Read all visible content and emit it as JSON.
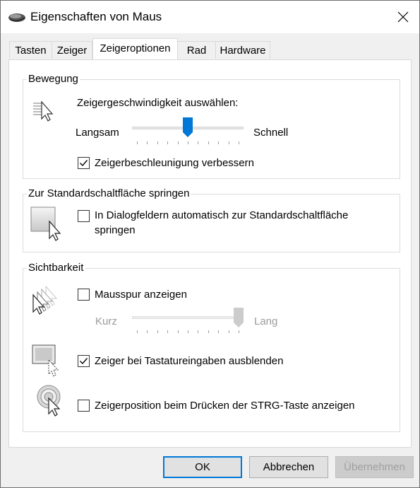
{
  "window": {
    "title": "Eigenschaften von Maus"
  },
  "tabs": [
    "Tasten",
    "Zeiger",
    "Zeigeroptionen",
    "Rad",
    "Hardware"
  ],
  "active_tab": "Zeigeroptionen",
  "motion": {
    "group_label": "Bewegung",
    "speed_label": "Zeigergeschwindigkeit auswählen:",
    "slow_label": "Langsam",
    "fast_label": "Schnell",
    "speed_value_fraction": 0.5,
    "accel_label": "Zeigerbeschleunigung verbessern",
    "accel_checked": true
  },
  "snap": {
    "group_label": "Zur Standardschaltfläche springen",
    "label_line1": "In Dialogfeldern automatisch zur Standardschaltfläche",
    "label_line2": "springen",
    "checked": false
  },
  "visibility": {
    "group_label": "Sichtbarkeit",
    "trails_label": "Mausspur anzeigen",
    "trails_checked": false,
    "short_label": "Kurz",
    "long_label": "Lang",
    "trails_value_fraction": 1.0,
    "hide_label": "Zeiger bei Tastatureingaben ausblenden",
    "hide_checked": true,
    "ctrl_label": "Zeigerposition beim Drücken der STRG-Taste anzeigen",
    "ctrl_checked": false
  },
  "buttons": {
    "ok": "OK",
    "cancel": "Abbrechen",
    "apply": "Übernehmen"
  },
  "colors": {
    "accent": "#0078d7",
    "default_border": "#0078d7"
  },
  "icons": [
    "mouse-icon",
    "close-icon",
    "pointer-speed-icon",
    "snap-to-icon",
    "pointer-trails-icon",
    "hide-pointer-icon",
    "ctrl-locate-icon"
  ]
}
